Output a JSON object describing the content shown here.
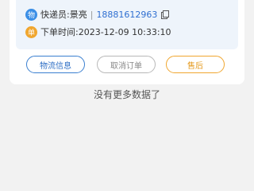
{
  "order_card": {
    "courier": {
      "badge": "物",
      "label": "快递员:景亮",
      "separator": "|",
      "phone": "18881612963",
      "copy_icon": "copy-icon"
    },
    "order_time": {
      "badge": "单",
      "label": "下单时间:2023-12-09 10:33:10"
    },
    "actions": {
      "logistics": "物流信息",
      "cancel": "取消订单",
      "aftersale": "售后"
    }
  },
  "footer": {
    "no_more": "没有更多数据了"
  },
  "colors": {
    "accent_blue": "#3a8ee6",
    "accent_orange": "#f0a62f",
    "info_bg": "#eef4fb",
    "page_bg": "#f2f2f2"
  }
}
